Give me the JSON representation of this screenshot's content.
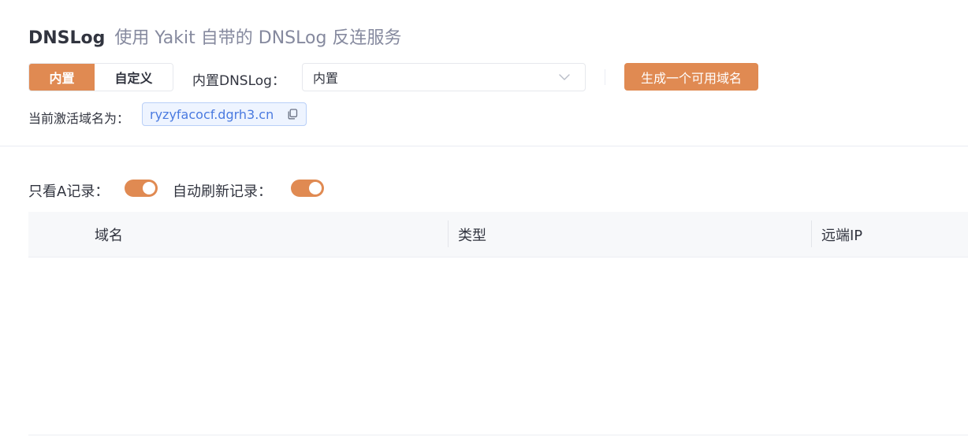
{
  "header": {
    "title": "DNSLog",
    "subtitle": "使用 Yakit 自带的 DNSLog 反连服务"
  },
  "mode_tabs": [
    {
      "label": "内置",
      "active": true
    },
    {
      "label": "自定义",
      "active": false
    }
  ],
  "dnslog_select": {
    "label": "内置DNSLog：",
    "value": "内置"
  },
  "generate_button": {
    "label": "生成一个可用域名"
  },
  "active_domain": {
    "label": "当前激活域名为：",
    "value": "ryzyfacocf.dgrh3.cn"
  },
  "filters": {
    "only_a_label": "只看A记录：",
    "only_a_enabled": true,
    "auto_refresh_label": "自动刷新记录：",
    "auto_refresh_enabled": true
  },
  "table": {
    "columns": [
      "域名",
      "类型",
      "远端IP"
    ],
    "rows": []
  },
  "colors": {
    "accent": "#e08a52",
    "tag_text": "#4a7ae0",
    "tag_bg": "#eef4ff"
  },
  "icons": {
    "select_arrow": "chevron-down-icon",
    "copy": "copy-icon"
  }
}
